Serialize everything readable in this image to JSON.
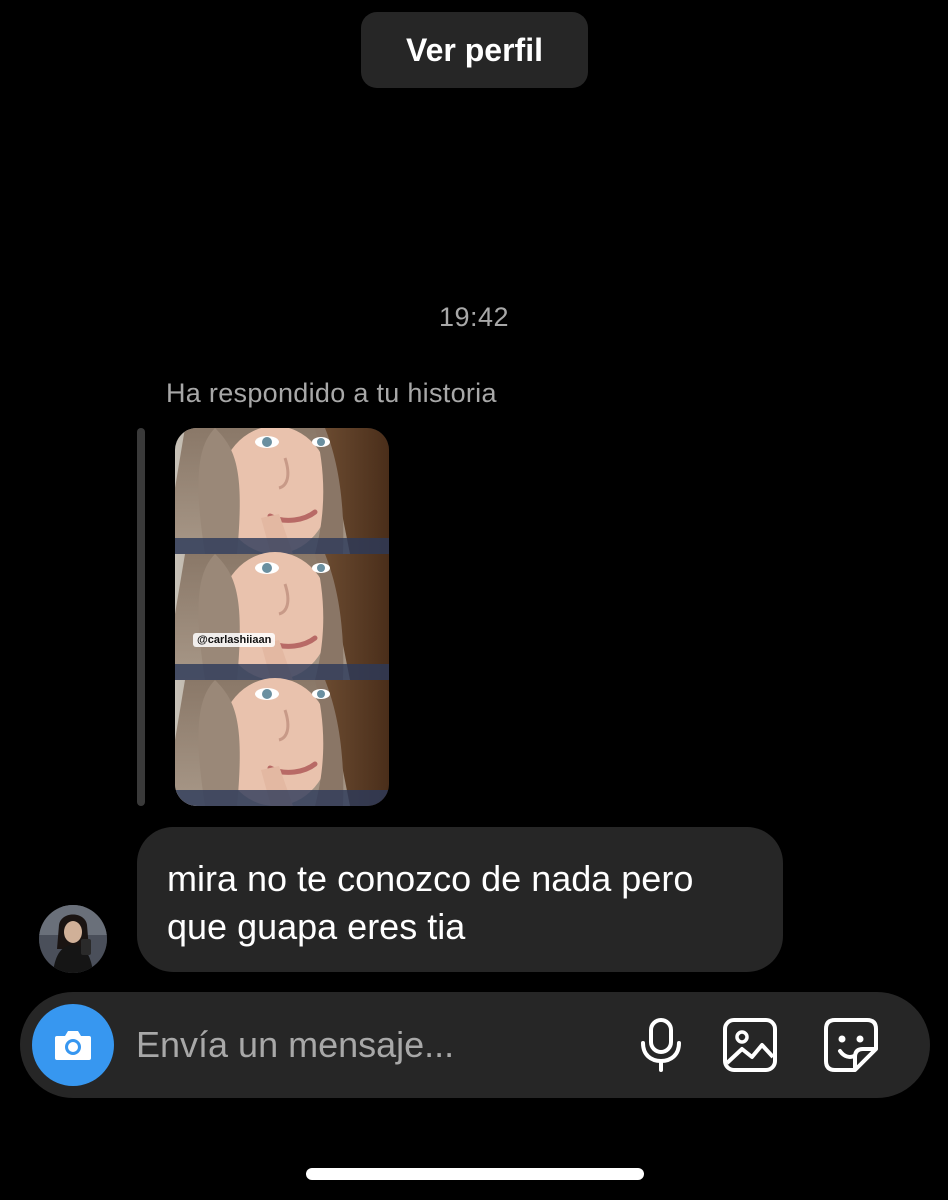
{
  "header": {
    "view_profile_label": "Ver perfil"
  },
  "conversation": {
    "timestamp": "19:42",
    "story_reply": {
      "label": "Ha respondido a tu historia",
      "story_mention": "@carlashiiaan"
    },
    "message": {
      "text": "mira no te conozco de nada pero que guapa eres tia"
    }
  },
  "composer": {
    "placeholder": "Envía un mensaje...",
    "icons": [
      "camera-icon",
      "microphone-icon",
      "image-icon",
      "sticker-icon"
    ]
  },
  "colors": {
    "background": "#000000",
    "bubble": "#262626",
    "secondary_text": "#a8a8a8",
    "accent": "#3797f0"
  }
}
